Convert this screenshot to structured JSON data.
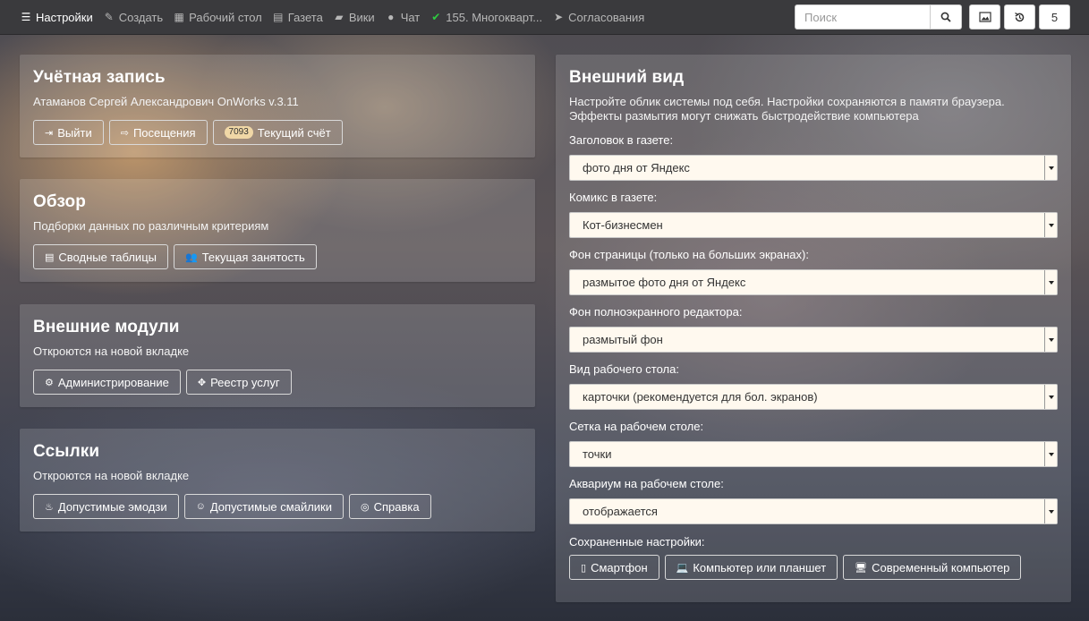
{
  "navbar": {
    "items": [
      {
        "label": "Настройки",
        "icon": "menu-icon"
      },
      {
        "label": "Создать",
        "icon": "pencil-icon"
      },
      {
        "label": "Рабочий стол",
        "icon": "grid-icon"
      },
      {
        "label": "Газета",
        "icon": "newspaper-icon"
      },
      {
        "label": "Вики",
        "icon": "book-icon"
      },
      {
        "label": "Чат",
        "icon": "chat-icon"
      },
      {
        "label": "155. Многокварт...",
        "icon": "check-circle-icon"
      },
      {
        "label": "Согласования",
        "icon": "send-icon"
      }
    ],
    "search_placeholder": "Поиск",
    "counter": "5"
  },
  "account": {
    "title": "Учётная запись",
    "desc": "Атаманов Сергей Александрович OnWorks v.3.11",
    "logout": "Выйти",
    "visits": "Посещения",
    "balance_badge": "7093",
    "balance": "Текущий счёт"
  },
  "overview": {
    "title": "Обзор",
    "desc": "Подборки данных по различным критериям",
    "pivot": "Сводные таблицы",
    "occupancy": "Текущая занятость"
  },
  "modules": {
    "title": "Внешние модули",
    "desc": "Откроются на новой вкладке",
    "admin": "Администрирование",
    "registry": "Реестр услуг"
  },
  "links": {
    "title": "Ссылки",
    "desc": "Откроются на новой вкладке",
    "emoji": "Допустимые эмодзи",
    "smileys": "Допустимые смайлики",
    "help": "Справка"
  },
  "appearance": {
    "title": "Внешний вид",
    "desc": "Настройте облик системы под себя. Настройки сохраняются в памяти браузера. Эффекты размытия могут снижать быстродействие компьютера",
    "fields": [
      {
        "label": "Заголовок в газете:",
        "value": "фото дня от Яндекс"
      },
      {
        "label": "Комикс в газете:",
        "value": "Кот-бизнесмен"
      },
      {
        "label": "Фон страницы (только на больших экранах):",
        "value": "размытое фото дня от Яндекс"
      },
      {
        "label": "Фон полноэкранного редактора:",
        "value": "размытый фон"
      },
      {
        "label": "Вид рабочего стола:",
        "value": "карточки (рекомендуется для бол. экранов)"
      },
      {
        "label": "Сетка на рабочем столе:",
        "value": "точки"
      },
      {
        "label": "Аквариум на рабочем столе:",
        "value": "отображается"
      }
    ],
    "saved_label": "Сохраненные настройки:",
    "presets": {
      "phone": "Смартфон",
      "tablet": "Компьютер или планшет",
      "desktop": "Современный компьютер"
    }
  }
}
